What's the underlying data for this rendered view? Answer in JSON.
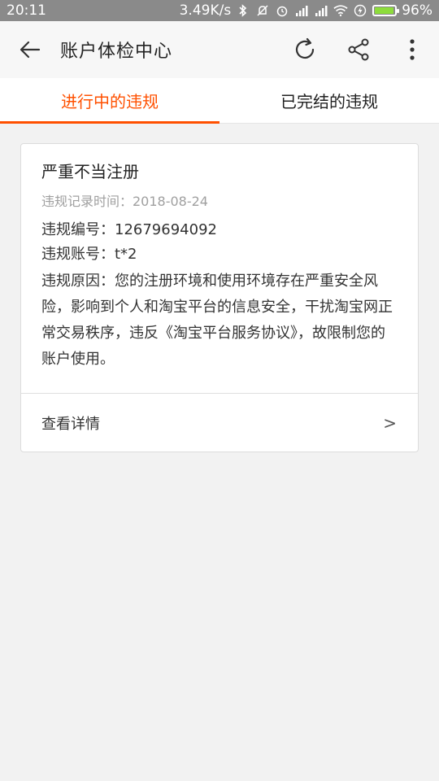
{
  "status_bar": {
    "time": "20:11",
    "network_speed": "3.49K/s",
    "battery_percent": "96%",
    "battery_level": 0.96,
    "icons": [
      "bluetooth-icon",
      "mute-icon",
      "alarm-icon",
      "signal-icon",
      "signal-icon",
      "wifi-icon",
      "charging-icon",
      "battery-icon"
    ]
  },
  "header": {
    "title": "账户体检中心"
  },
  "tabs": [
    {
      "label": "进行中的违规",
      "active": true
    },
    {
      "label": "已完结的违规",
      "active": false
    }
  ],
  "card": {
    "title": "严重不当注册",
    "record_time": "违规记录时间：2018-08-24",
    "number_label": "违规编号：",
    "number_value": "12679694092",
    "account_label": "违规账号：",
    "account_value": "t*2",
    "reason_label": "违规原因：",
    "reason_text": "您的注册环境和使用环境存在严重安全风险，影响到个人和淘宝平台的信息安全，干扰淘宝网正常交易秩序，违反《淘宝平台服务协议》，故限制您的账户使用。",
    "detail_label": "查看详情",
    "chevron": ">"
  },
  "colors": {
    "accent": "#ff5000",
    "status_bar": "#8a8a8a",
    "background": "#f2f2f2"
  }
}
